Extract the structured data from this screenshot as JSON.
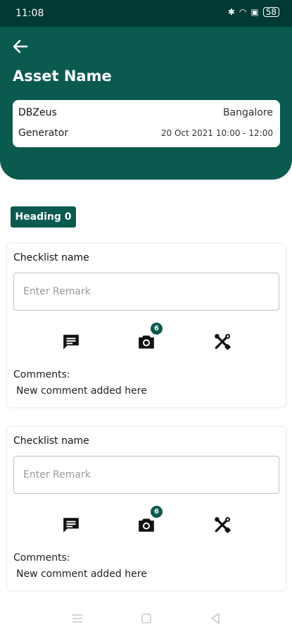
{
  "status_bar": {
    "time": "11:08",
    "battery": "58"
  },
  "header": {
    "title": "Asset Name"
  },
  "asset": {
    "name": "DBZeus",
    "location": "Bangalore",
    "type": "Generator",
    "schedule": "20 Oct 2021 10:00 - 12:00"
  },
  "section": {
    "heading": "Heading 0"
  },
  "checklists": [
    {
      "name": "Checklist name",
      "remark_placeholder": "Enter Remark",
      "photo_count": "6",
      "comments_label": "Comments:",
      "comment": "New comment added here"
    },
    {
      "name": "Checklist name",
      "remark_placeholder": "Enter Remark",
      "photo_count": "6",
      "comments_label": "Comments:",
      "comment": "New comment added here"
    }
  ],
  "icons": {
    "back": "arrow-left-icon",
    "comment": "comment-icon",
    "camera": "camera-icon",
    "tools": "tools-icon"
  },
  "colors": {
    "primary": "#0b5a4f",
    "status_bar": "#003a32"
  }
}
